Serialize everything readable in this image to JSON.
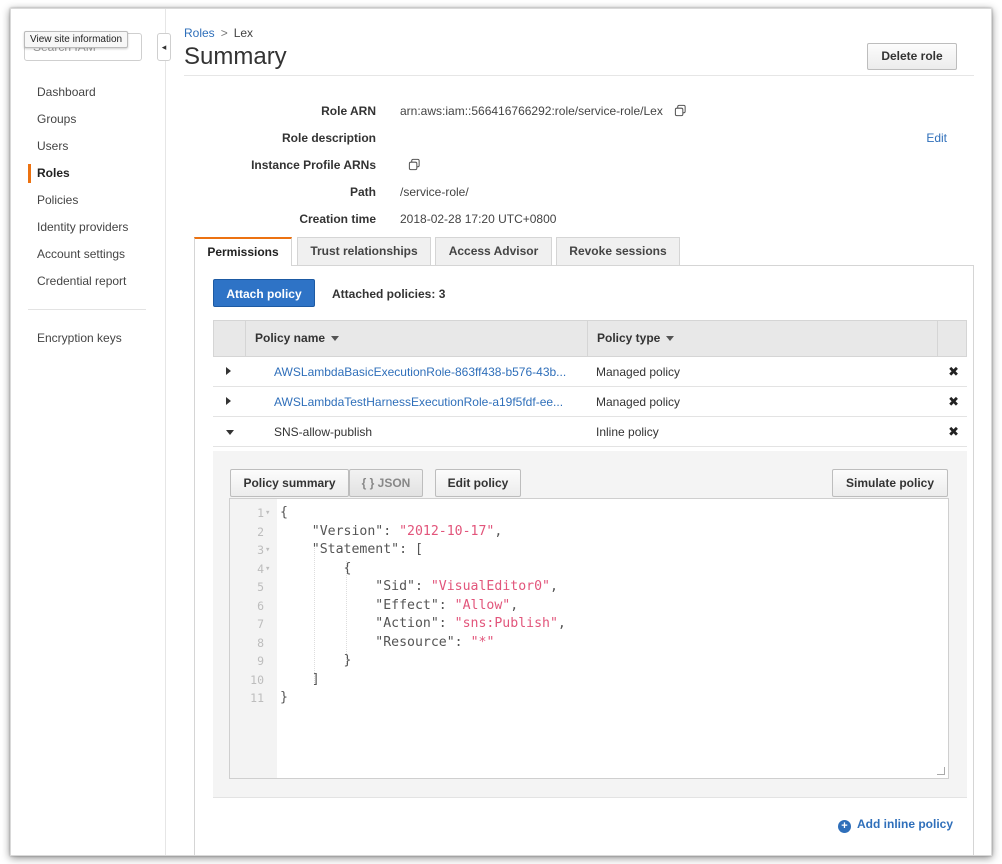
{
  "sidebar": {
    "search_placeholder": "Search IAM",
    "tooltip": "View site information",
    "collapse_glyph": "◂",
    "items": [
      {
        "label": "Dashboard"
      },
      {
        "label": "Groups"
      },
      {
        "label": "Users"
      },
      {
        "label": "Roles",
        "active": true
      },
      {
        "label": "Policies"
      },
      {
        "label": "Identity providers"
      },
      {
        "label": "Account settings"
      },
      {
        "label": "Credential report"
      }
    ],
    "extra_item": "Encryption keys"
  },
  "breadcrumb": {
    "parent": "Roles",
    "separator": ">",
    "current": "Lex"
  },
  "page": {
    "title": "Summary",
    "delete_label": "Delete role"
  },
  "details": {
    "role_arn_label": "Role ARN",
    "role_arn_value": "arn:aws:iam::566416766292:role/service-role/Lex",
    "role_description_label": "Role description",
    "edit_label": "Edit",
    "instance_profile_label": "Instance Profile ARNs",
    "path_label": "Path",
    "path_value": "/service-role/",
    "creation_time_label": "Creation time",
    "creation_time_value": "2018-02-28 17:20 UTC+0800"
  },
  "tabs": [
    {
      "label": "Permissions",
      "active": true
    },
    {
      "label": "Trust relationships"
    },
    {
      "label": "Access Advisor"
    },
    {
      "label": "Revoke sessions"
    }
  ],
  "permissions": {
    "attach_label": "Attach policy",
    "attached_count": "Attached policies: 3",
    "columns": {
      "name": "Policy name",
      "type": "Policy type"
    },
    "policies": [
      {
        "name": "AWSLambdaBasicExecutionRole-863ff438-b576-43b...",
        "type": "Managed policy",
        "expanded": false,
        "link": true
      },
      {
        "name": "AWSLambdaTestHarnessExecutionRole-a19f5fdf-ee...",
        "type": "Managed policy",
        "expanded": false,
        "link": true
      },
      {
        "name": "SNS-allow-publish",
        "type": "Inline policy",
        "expanded": true,
        "link": false
      }
    ],
    "remove_glyph": "✖",
    "add_inline_label": "Add inline policy"
  },
  "policy_view": {
    "summary_label": "Policy summary",
    "json_label": "{ } JSON",
    "edit_label": "Edit policy",
    "simulate_label": "Simulate policy",
    "code_lines": [
      {
        "n": "1",
        "fold": "▾",
        "code": "{"
      },
      {
        "n": "2",
        "fold": "",
        "code": "    \"Version\": \"2012-10-17\","
      },
      {
        "n": "3",
        "fold": "▾",
        "code": "    \"Statement\": ["
      },
      {
        "n": "4",
        "fold": "▾",
        "code": "        {"
      },
      {
        "n": "5",
        "fold": "",
        "code": "            \"Sid\": \"VisualEditor0\","
      },
      {
        "n": "6",
        "fold": "",
        "code": "            \"Effect\": \"Allow\","
      },
      {
        "n": "7",
        "fold": "",
        "code": "            \"Action\": \"sns:Publish\","
      },
      {
        "n": "8",
        "fold": "",
        "code": "            \"Resource\": \"*\""
      },
      {
        "n": "9",
        "fold": "",
        "code": "        }"
      },
      {
        "n": "10",
        "fold": "",
        "code": "    ]"
      },
      {
        "n": "11",
        "fold": "",
        "code": "}"
      }
    ]
  },
  "colors": {
    "accent": "#ec7211",
    "link": "#2f6fba",
    "primary_button": "#2e73c6",
    "json_string": "#e2557b"
  },
  "icons": {
    "copy": "copy-icon",
    "remove": "remove-x-icon",
    "add": "plus-circle-icon",
    "collapse": "collapse-left-icon"
  }
}
